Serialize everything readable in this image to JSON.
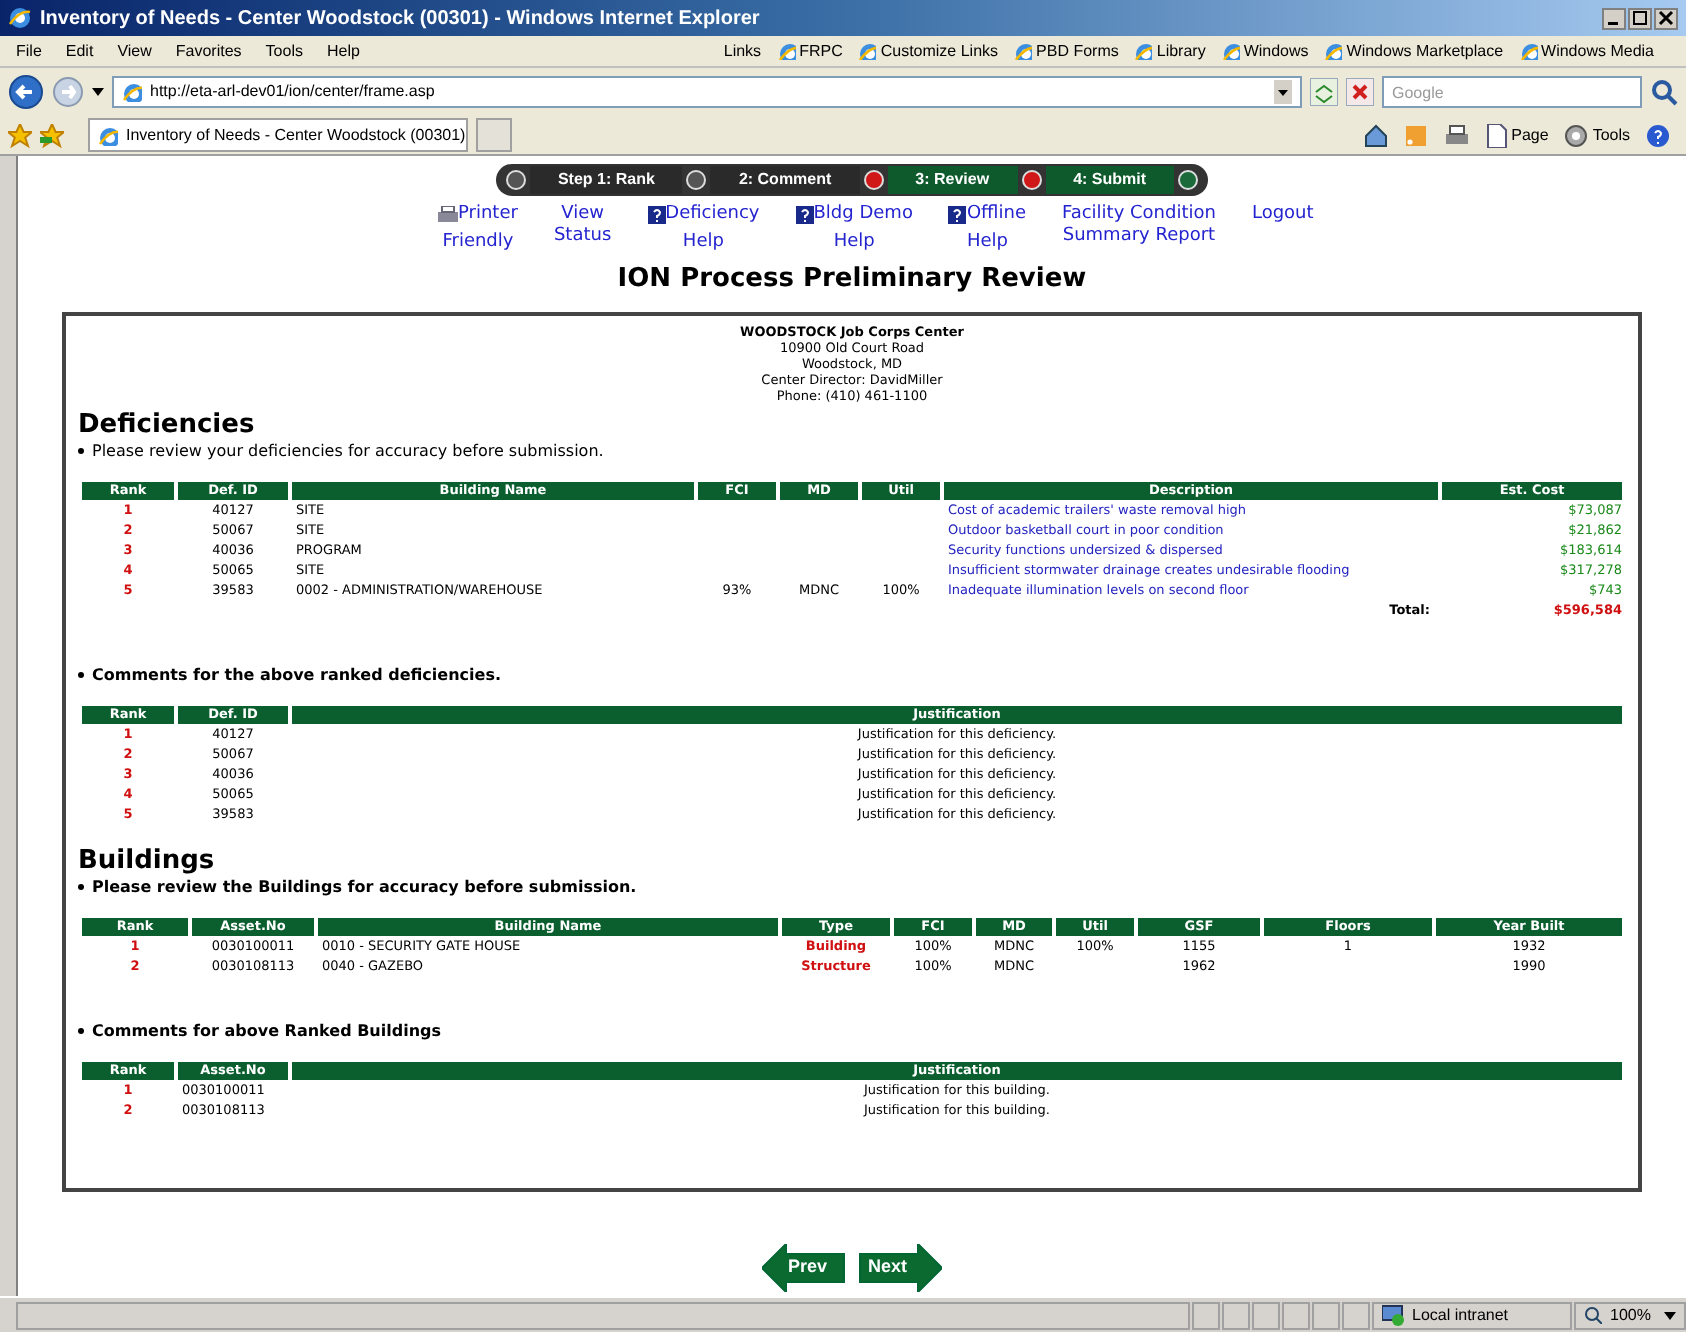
{
  "window": {
    "title": "Inventory of Needs - Center Woodstock (00301) - Windows Internet Explorer"
  },
  "menu": [
    "File",
    "Edit",
    "View",
    "Favorites",
    "Tools",
    "Help"
  ],
  "links_bar": {
    "label": "Links",
    "items": [
      "FRPC",
      "Customize Links",
      "PBD Forms",
      "Library",
      "Windows",
      "Windows Marketplace",
      "Windows Media"
    ]
  },
  "address": "http://eta-arl-dev01/ion/center/frame.asp",
  "search": {
    "placeholder": "Google"
  },
  "tab": {
    "title": "Inventory of Needs - Center Woodstock (00301)"
  },
  "command_bar": [
    "Page",
    "Tools"
  ],
  "steps": [
    {
      "label": "Step 1: Rank",
      "done": true
    },
    {
      "label": "2: Comment",
      "done": true
    },
    {
      "label": "3: Review",
      "done": false
    },
    {
      "label": "4: Submit",
      "done": false
    }
  ],
  "nav_links": [
    {
      "lines": [
        "Printer",
        "Friendly"
      ],
      "kind": "print"
    },
    {
      "lines": [
        "View",
        "Status"
      ],
      "kind": "plain"
    },
    {
      "lines": [
        "Deficiency",
        "Help"
      ],
      "kind": "help"
    },
    {
      "lines": [
        "Bldg Demo",
        "Help"
      ],
      "kind": "help"
    },
    {
      "lines": [
        "Offline",
        "Help"
      ],
      "kind": "help"
    },
    {
      "lines": [
        "Facility Condition",
        "Summary Report"
      ],
      "kind": "plain"
    },
    {
      "lines": [
        "Logout"
      ],
      "kind": "plain"
    }
  ],
  "page_title": "ION Process Preliminary Review",
  "center": {
    "name": "WOODSTOCK Job Corps Center",
    "lines": [
      "10900 Old Court Road",
      "Woodstock, MD",
      "Center Director: DavidMiller",
      "Phone: (410) 461-1100"
    ]
  },
  "deficiencies": {
    "heading": "Deficiencies",
    "note": "Please review your deficiencies for accuracy before submission.",
    "columns": [
      "Rank",
      "Def. ID",
      "Building Name",
      "FCI",
      "MD",
      "Util",
      "Description",
      "Est. Cost"
    ],
    "rows": [
      [
        "1",
        "40127",
        "SITE",
        "",
        "",
        "",
        "Cost of academic trailers' waste removal high",
        "$73,087"
      ],
      [
        "2",
        "50067",
        "SITE",
        "",
        "",
        "",
        "Outdoor basketball court in poor condition",
        "$21,862"
      ],
      [
        "3",
        "40036",
        "PROGRAM",
        "",
        "",
        "",
        "Security functions undersized & dispersed",
        "$183,614"
      ],
      [
        "4",
        "50065",
        "SITE",
        "",
        "",
        "",
        "Insufficient stormwater drainage creates undesirable flooding",
        "$317,278"
      ],
      [
        "5",
        "39583",
        "0002 - ADMINISTRATION/WAREHOUSE",
        "93%",
        "MDNC",
        "100%",
        "Inadequate illumination levels on second floor",
        "$743"
      ]
    ],
    "total_label": "Total:",
    "total": "$596,584"
  },
  "deficiency_comments": {
    "heading": "Comments for the above ranked deficiencies.",
    "columns": [
      "Rank",
      "Def. ID",
      "Justification"
    ],
    "rows": [
      [
        "1",
        "40127",
        "Justification for this deficiency."
      ],
      [
        "2",
        "50067",
        "Justification for this deficiency."
      ],
      [
        "3",
        "40036",
        "Justification for this deficiency."
      ],
      [
        "4",
        "50065",
        "Justification for this deficiency."
      ],
      [
        "5",
        "39583",
        "Justification for this deficiency."
      ]
    ]
  },
  "buildings": {
    "heading": "Buildings",
    "note": "Please review the Buildings for accuracy before submission.",
    "columns": [
      "Rank",
      "Asset.No",
      "Building Name",
      "Type",
      "FCI",
      "MD",
      "Util",
      "GSF",
      "Floors",
      "Year Built"
    ],
    "rows": [
      [
        "1",
        "0030100011",
        "0010 - SECURITY GATE HOUSE",
        "Building",
        "100%",
        "MDNC",
        "100%",
        "1155",
        "1",
        "1932"
      ],
      [
        "2",
        "0030108113",
        "0040 - GAZEBO",
        "Structure",
        "100%",
        "MDNC",
        "",
        "1962",
        "",
        "1990"
      ]
    ]
  },
  "building_comments": {
    "heading": "Comments for above Ranked Buildings",
    "columns": [
      "Rank",
      "Asset.No",
      "Justification"
    ],
    "rows": [
      [
        "1",
        "0030100011",
        "Justification for this building."
      ],
      [
        "2",
        "0030108113",
        "Justification for this building."
      ]
    ]
  },
  "pager": {
    "prev": "Prev",
    "next": "Next"
  },
  "status_bar": {
    "zone": "Local intranet",
    "zoom": "100%"
  }
}
